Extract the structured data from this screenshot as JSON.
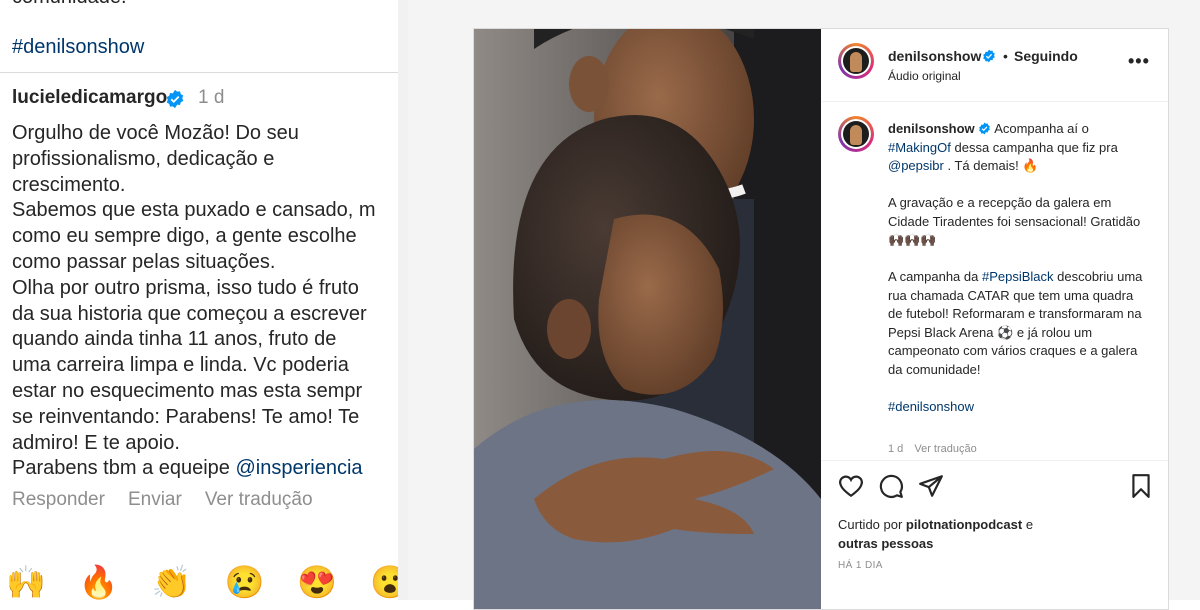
{
  "left": {
    "prev_text": "comunidade.",
    "prev_hashtag": "#denilsonshow",
    "comment": {
      "username": "lucieledicamargo",
      "time": "1 d",
      "text": "Orgulho de você Mozão! Do seu\nprofissionalismo, dedicação e\ncrescimento.\nSabemos que esta puxado e cansado, m\ncomo eu sempre digo, a gente escolhe\ncomo passar pelas situações.\nOlha por outro prisma, isso tudo é fruto\nda sua historia que começou a escrever\nquando ainda tinha 11 anos, fruto de\numa carreira limpa e linda. Vc poderia\nestar no esquecimento mas esta sempr\nse reinventando: Parabens! Te amo! Te\nadmiro! E te apoio.\nParabens tbm a equeipe ",
      "mention": "@insperiencia",
      "reply_label": "Responder",
      "send_label": "Enviar",
      "translate_label": "Ver tradução"
    },
    "emojis": [
      "🙌",
      "🔥",
      "👏",
      "😢",
      "😍",
      "😮"
    ]
  },
  "post": {
    "username": "denilsonshow",
    "dot": "•",
    "follow_label": "Seguindo",
    "audio": "Áudio original",
    "more": "•••",
    "caption": {
      "username": "denilsonshow",
      "line1_text": " Acompanha aí o ",
      "tag_making": "#MakingOf",
      "line1b": " dessa campanha que fiz pra ",
      "tag_pepsi": "@pepsibr",
      "line1c": " . Tá demais! 🔥",
      "p2": "A gravação e a recepção da galera em Cidade Tiradentes foi sensacional! Gratidão 🙌🏿🙌🏿🙌🏿",
      "p3a": "A campanha da ",
      "tag_black": "#PepsiBlack",
      "p3b": " descobriu uma rua chamada CATAR que tem uma quadra de futebol! Reformaram e transformaram na Pepsi Black Arena ⚽ e já rolou um campeonato com vários craques e a galera da comunidade!",
      "hashtag": "#denilsonshow",
      "meta_time": "1 d",
      "meta_translate": "Ver tradução"
    },
    "liked_prefix": "Curtido por ",
    "liked_user": "pilotnationpodcast",
    "liked_mid": " e",
    "liked_others": "outras pessoas",
    "when": "HÁ 1 DIA"
  },
  "colors": {
    "link": "#00376b",
    "secondary": "#8e8e8e",
    "verified": "#0095f6"
  }
}
